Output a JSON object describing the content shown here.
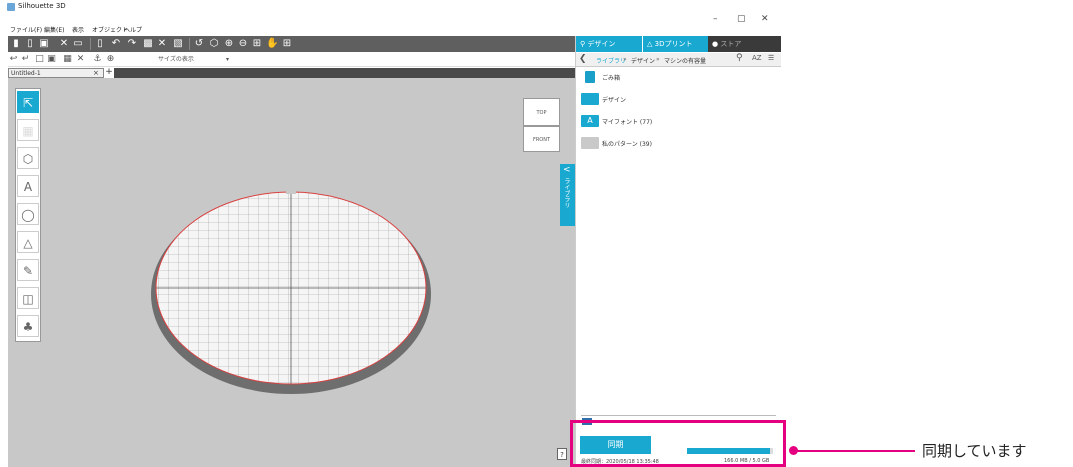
{
  "app": {
    "title": "Silhouette 3D",
    "window_controls": {
      "minimize": "–",
      "maximize": "▢",
      "close": "✕"
    }
  },
  "menu": [
    "ファイル(F)",
    "編集(E)",
    "表示",
    "オブジェクト",
    "ヘルプ"
  ],
  "toolbar2": {
    "size_select": "サイズの表示",
    "size_select_arrow": "▾"
  },
  "document_tab": {
    "label": "Untitled-1",
    "close": "×",
    "add": "+"
  },
  "view_cube": {
    "top": "TOP",
    "front": "FRONT"
  },
  "library_toggle": {
    "arrow": "<",
    "label": "ライブラリ"
  },
  "help_button": "?",
  "panel": {
    "tabs": [
      {
        "label": "デザイン",
        "icon": "globe-icon"
      },
      {
        "label": "3Dプリント",
        "icon": "printer-icon"
      },
      {
        "label": "ストア",
        "icon": "store-icon"
      }
    ],
    "breadcrumb": [
      "ライブラリ",
      "デザイン",
      "マシンの有容量"
    ],
    "breadcrumb_sep": "»",
    "sort_label": "AZ",
    "items": [
      {
        "label": "ごみ箱",
        "icon": "trash-icon",
        "color": "#1aa0c8"
      },
      {
        "label": "デザイン",
        "icon": "folder-icon",
        "color": "#19a9d0"
      },
      {
        "label": "マイフォント (77)",
        "icon": "font-icon",
        "color": "#19a9d0"
      },
      {
        "label": "私のパターン (39)",
        "icon": "pattern-icon",
        "color": "#c9c9c9"
      }
    ]
  },
  "sync": {
    "button": "同期",
    "last_sync": "最終同期：2020/05/18 13:35:48",
    "usage": "166.0 MB / 5.0 GB",
    "progress_fraction": 0.97
  },
  "callout": {
    "text": "同期しています"
  },
  "colors": {
    "accent": "#19a9d0",
    "highlight": "#e4007f",
    "toolbar": "#5f5f5f",
    "canvas": "#c8c8c8"
  }
}
